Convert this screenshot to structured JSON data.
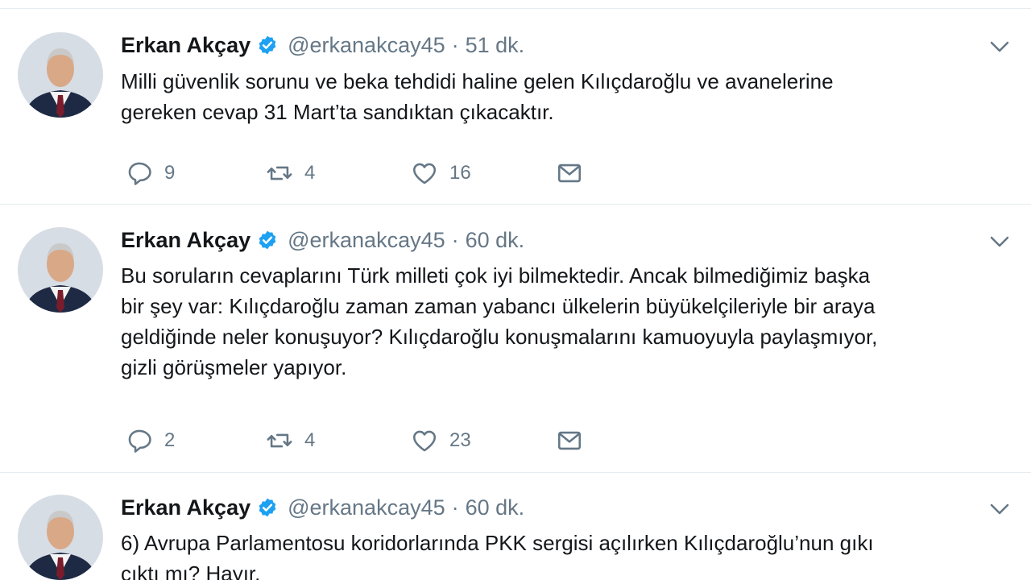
{
  "tweets": [
    {
      "name": "Erkan Akçay",
      "handle": "@erkanakcay45",
      "separator": "·",
      "time": "51 dk.",
      "lines": [
        "Milli güvenlik sorunu ve beka tehdidi haline gelen Kılıçdaroğlu ve avanelerine",
        "gereken cevap 31 Mart’ta sandıktan çıkacaktır."
      ],
      "replies": "9",
      "retweets": "4",
      "likes": "16"
    },
    {
      "name": "Erkan Akçay",
      "handle": "@erkanakcay45",
      "separator": "·",
      "time": "60 dk.",
      "lines": [
        "Bu soruların cevaplarını Türk milleti çok iyi bilmektedir. Ancak bilmediğimiz başka",
        "bir şey var: Kılıçdaroğlu zaman zaman yabancı ülkelerin büyükelçileriyle bir araya",
        "geldiğinde neler konuşuyor? Kılıçdaroğlu konuşmalarını kamuoyuyla paylaşmıyor,",
        "gizli görüşmeler yapıyor."
      ],
      "replies": "2",
      "retweets": "4",
      "likes": "23"
    },
    {
      "name": "Erkan Akçay",
      "handle": "@erkanakcay45",
      "separator": "·",
      "time": "60 dk.",
      "lines": [
        "6) Avrupa Parlamentosu koridorlarında PKK sergisi açılırken Kılıçdaroğlu’nun gıkı",
        "çıktı mı? Hayır."
      ]
    }
  ],
  "colors": {
    "verified": "#1da1f2",
    "muted": "#657786",
    "text": "#14171a",
    "divider": "#e6ecf0"
  },
  "icons": [
    "verified-badge-icon",
    "chevron-down-icon",
    "reply-icon",
    "retweet-icon",
    "like-icon",
    "direct-message-icon"
  ]
}
